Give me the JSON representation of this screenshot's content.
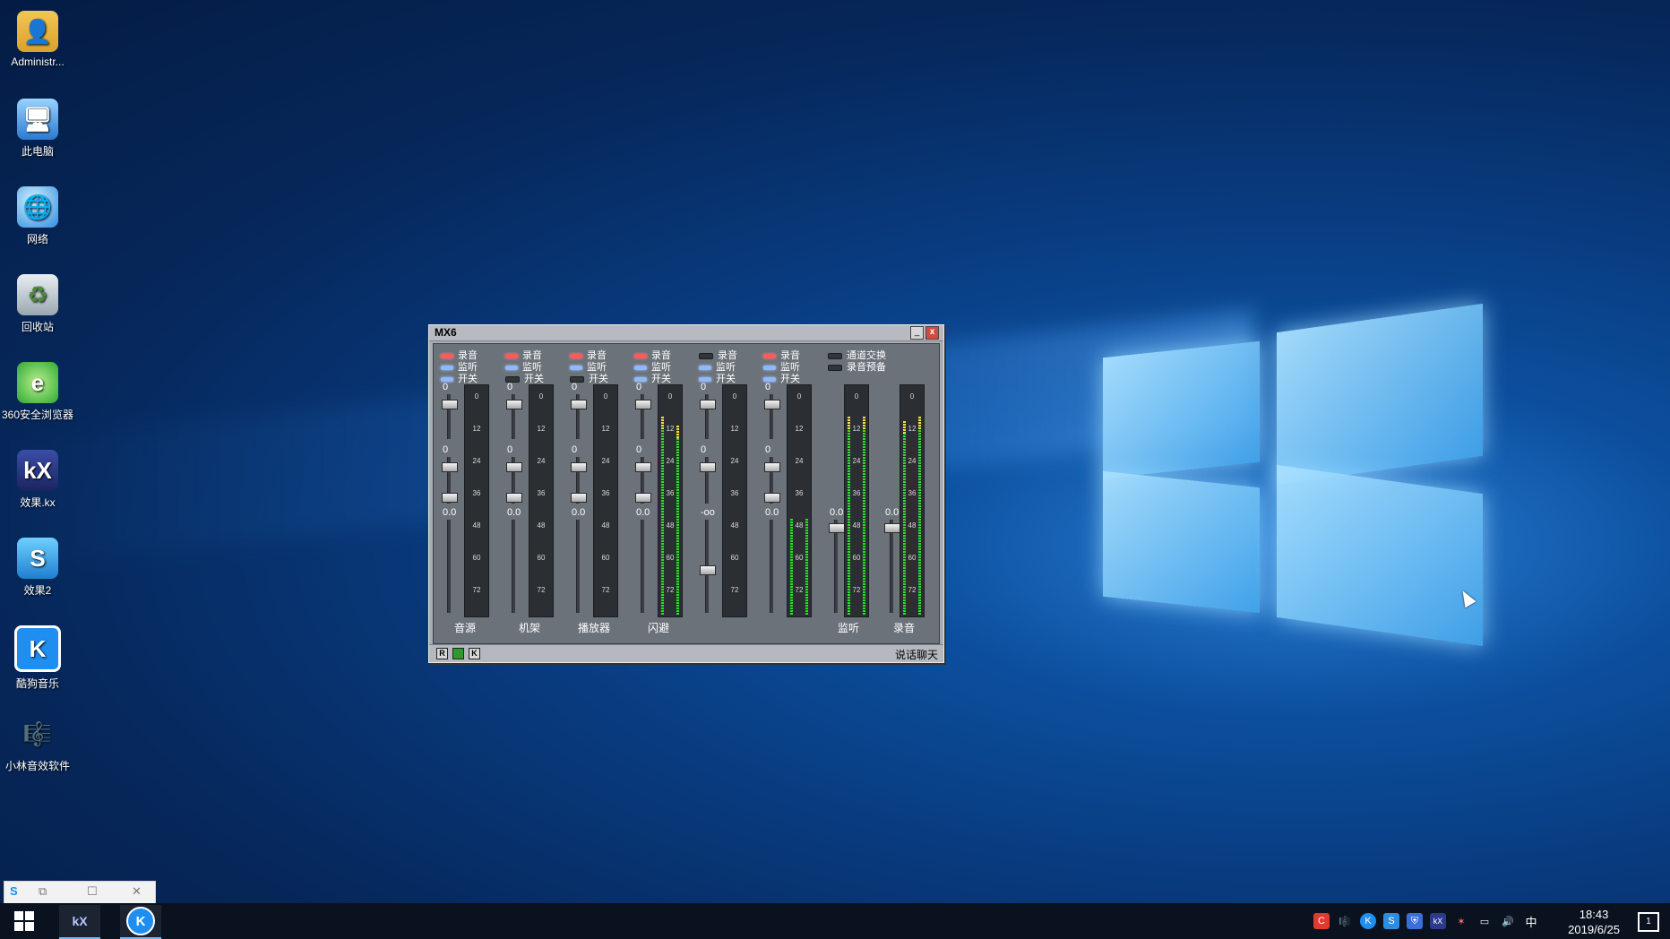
{
  "desktop": {
    "icons": [
      {
        "label": "Administr...",
        "icon": "user-folder-icon",
        "glyph": "👤"
      },
      {
        "label": "此电脑",
        "icon": "computer-icon",
        "glyph": "🖥"
      },
      {
        "label": "网络",
        "icon": "network-icon",
        "glyph": "🌐"
      },
      {
        "label": "回收站",
        "icon": "recycle-bin-icon",
        "glyph": "♻"
      },
      {
        "label": "360安全浏览器",
        "icon": "browser-360-icon",
        "glyph": "e"
      },
      {
        "label": "效果.kx",
        "icon": "kx-file-icon",
        "glyph": "kX"
      },
      {
        "label": "效果2",
        "icon": "s-app-icon",
        "glyph": "S"
      },
      {
        "label": "酷狗音乐",
        "icon": "kugou-music-icon",
        "glyph": "K"
      },
      {
        "label": "小林音效软件",
        "icon": "conductor-icon",
        "glyph": "🎼"
      }
    ]
  },
  "mixer": {
    "title": "MX6",
    "minimize": "_",
    "close": "x",
    "option_labels": {
      "record": "录音",
      "monitor": "监听",
      "switch": "开关"
    },
    "extra_options": [
      "通道交换",
      "录音预备"
    ],
    "meter_scale": [
      "0",
      "12",
      "24",
      "36",
      "48",
      "60",
      "72"
    ],
    "strips": [
      {
        "name": "音源",
        "leds": [
          "red",
          "blue",
          "blue"
        ],
        "fader1": "0",
        "fader2": "0",
        "fader3": "0.0",
        "level_l": 0.0,
        "level_r": 0.0
      },
      {
        "name": "机架",
        "leds": [
          "red",
          "blue",
          "gray"
        ],
        "fader1": "0",
        "fader2": "0",
        "fader3": "0.0",
        "level_l": 0.0,
        "level_r": 0.0
      },
      {
        "name": "播放器",
        "leds": [
          "red",
          "blue",
          "gray"
        ],
        "fader1": "0",
        "fader2": "0",
        "fader3": "0.0",
        "level_l": 0.0,
        "level_r": 0.0
      },
      {
        "name": "闪避",
        "leds": [
          "red",
          "blue",
          "blue"
        ],
        "fader1": "0",
        "fader2": "0",
        "fader3": "0.0",
        "level_l": 0.92,
        "level_r": 0.88
      },
      {
        "name": "",
        "leds": [
          "gray",
          "blue",
          "blue"
        ],
        "fader1": "0",
        "fader2": "0",
        "fader3": "-oo",
        "level_l": 0.0,
        "level_r": 0.0
      },
      {
        "name": "",
        "leds": [
          "red",
          "blue",
          "blue"
        ],
        "fader1": "0",
        "fader2": "0",
        "fader3": "0.0",
        "level_l": 0.45,
        "level_r": 0.45
      }
    ],
    "master_strips": [
      {
        "name": "监听",
        "value": "0.0",
        "level_l": 0.92,
        "level_r": 0.92
      },
      {
        "name": "录音",
        "value": "0.0",
        "level_l": 0.9,
        "level_r": 0.92
      }
    ],
    "status_buttons": [
      "R",
      "",
      "K"
    ],
    "status_text": "说话聊天"
  },
  "taskbar": {
    "time": "18:43",
    "date": "2019/6/25",
    "ime": "中",
    "notification_count": "1"
  }
}
